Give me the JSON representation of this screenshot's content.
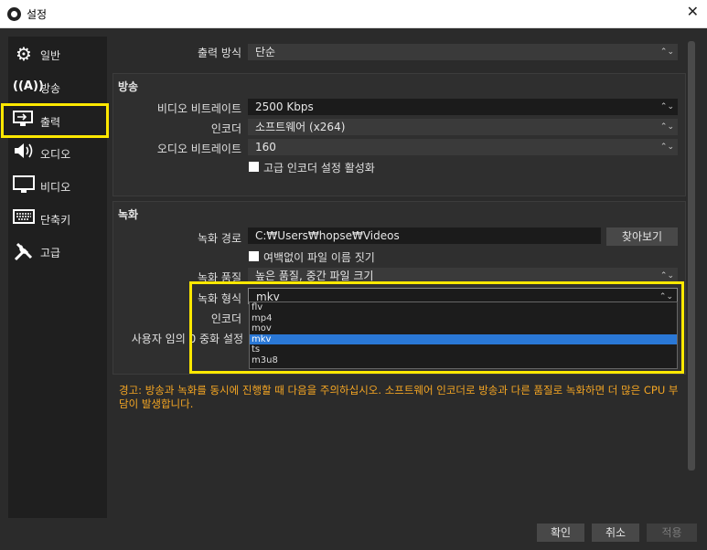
{
  "window": {
    "title": "설정",
    "close_label": "✕"
  },
  "sidebar": {
    "items": [
      {
        "label": "일반",
        "icon": "gear-icon",
        "glyph": "⚙"
      },
      {
        "label": "방송",
        "icon": "broadcast-antenna-icon",
        "glyph": "📡"
      },
      {
        "label": "출력",
        "icon": "output-monitor-icon",
        "glyph": "🖥"
      },
      {
        "label": "오디오",
        "icon": "speaker-icon",
        "glyph": "🔊"
      },
      {
        "label": "비디오",
        "icon": "monitor-icon",
        "glyph": "🖵"
      },
      {
        "label": "단축키",
        "icon": "keyboard-icon",
        "glyph": "⌨"
      },
      {
        "label": "고급",
        "icon": "wrench-screwdriver-icon",
        "glyph": "✗"
      }
    ],
    "active_index": 2
  },
  "output_mode": {
    "label": "출력 방식",
    "value": "단순"
  },
  "streaming": {
    "title": "방송",
    "video_bitrate": {
      "label": "비디오 비트레이트",
      "value": "2500 Kbps"
    },
    "encoder": {
      "label": "인코더",
      "value": "소프트웨어 (x264)"
    },
    "audio_bitrate": {
      "label": "오디오 비트레이트",
      "value": "160"
    },
    "advanced_encoder": {
      "label": "고급 인코더 설정 활성화"
    }
  },
  "recording": {
    "title": "녹화",
    "path": {
      "label": "녹화 경로",
      "value": "C:₩Users₩hopse₩Videos",
      "browse_label": "찾아보기"
    },
    "no_space": {
      "label": "여백없이 파일 이름 짓기"
    },
    "quality": {
      "label": "녹화 품질",
      "value": "높은 품질, 중간 파일 크기"
    },
    "format": {
      "label": "녹화 형식",
      "value": "mkv",
      "options": [
        "flv",
        "mp4",
        "mov",
        "mkv",
        "ts",
        "m3u8"
      ],
      "selected_index": 3
    },
    "encoder": {
      "label": "인코더"
    },
    "custom_muxer": {
      "label": "사용자 임의 0 중화 설정"
    }
  },
  "warning": "경고: 방송과 녹화를 동시에 진행할 때 다음을 주의하십시오. 소프트웨어 인코더로 방송과 다른 품질로 녹화하면 더 많은 CPU 부담이 발생합니다.",
  "footer": {
    "ok": "확인",
    "cancel": "취소",
    "apply": "적용"
  },
  "colors": {
    "highlight": "#ffe800",
    "selection": "#2a78d6",
    "warning": "#f5a623"
  }
}
